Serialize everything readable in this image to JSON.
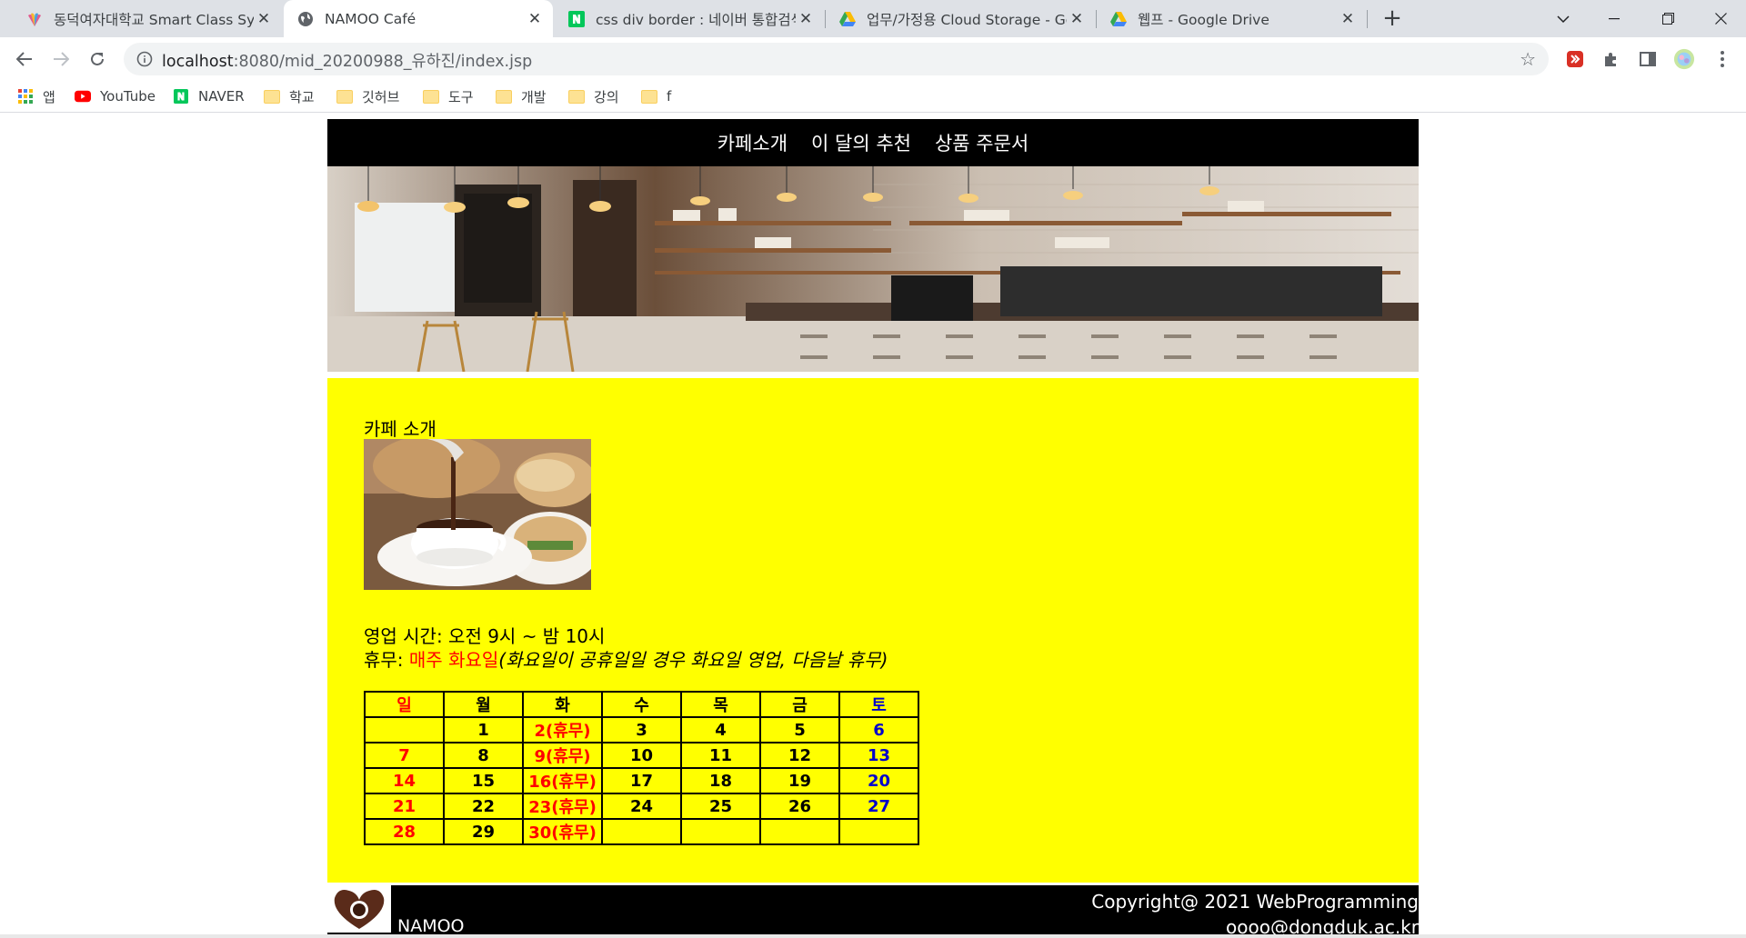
{
  "browser": {
    "tabs": [
      {
        "title": "동덕여자대학교 Smart Class Sys",
        "favicon": "dongduk-logo-icon",
        "active": false
      },
      {
        "title": "NAMOO Café",
        "favicon": "globe-icon",
        "active": true
      },
      {
        "title": "css div border : 네이버 통합검색",
        "favicon": "naver-icon",
        "active": false
      },
      {
        "title": "업무/가정용 Cloud Storage - Go",
        "favicon": "google-drive-icon",
        "active": false
      },
      {
        "title": "웹프 - Google Drive",
        "favicon": "google-drive-icon",
        "active": false
      }
    ],
    "url": {
      "host": "localhost",
      "path": ":8080/mid_20200988_유하진/index.jsp"
    },
    "bookmarks": [
      {
        "label": "앱",
        "icon": "apps-grid-icon"
      },
      {
        "label": "YouTube",
        "icon": "youtube-icon"
      },
      {
        "label": "NAVER",
        "icon": "naver-icon"
      },
      {
        "label": "학교",
        "icon": "folder-icon"
      },
      {
        "label": "깃허브",
        "icon": "folder-icon"
      },
      {
        "label": "도구",
        "icon": "folder-icon"
      },
      {
        "label": "개발",
        "icon": "folder-icon"
      },
      {
        "label": "강의",
        "icon": "folder-icon"
      },
      {
        "label": "f",
        "icon": "folder-icon"
      }
    ]
  },
  "site": {
    "nav": [
      "카페소개",
      "이 달의 추천",
      "상품 주문서"
    ],
    "intro_heading": "카페 소개",
    "hours_label": "영업 시간: 오전 9시 ~ 밤 10시",
    "holiday_prefix": "휴무: ",
    "holiday_day": "매주 화요일",
    "holiday_note": "(화요일이 공휴일일 경우 화요일 영업, 다음날 휴무)",
    "calendar": {
      "headers": [
        "일",
        "월",
        "화",
        "수",
        "목",
        "금",
        "토"
      ],
      "rows": [
        [
          "",
          "1",
          "2(휴무)",
          "3",
          "4",
          "5",
          "6"
        ],
        [
          "7",
          "8",
          "9(휴무)",
          "10",
          "11",
          "12",
          "13"
        ],
        [
          "14",
          "15",
          "16(휴무)",
          "17",
          "18",
          "19",
          "20"
        ],
        [
          "21",
          "22",
          "23(휴무)",
          "24",
          "25",
          "26",
          "27"
        ],
        [
          "28",
          "29",
          "30(휴무)",
          "",
          "",
          "",
          ""
        ]
      ]
    },
    "footer": {
      "brand": "NAMOO",
      "copyright": "Copyright@ 2021 WebProgramming",
      "email": "oooo@dongduk.ac.kr"
    }
  },
  "colors": {
    "content_bg": "#ffff00",
    "nav_bg": "#000000",
    "sunday": "#ff0000",
    "saturday": "#0000cc",
    "holiday": "#ff0000"
  }
}
